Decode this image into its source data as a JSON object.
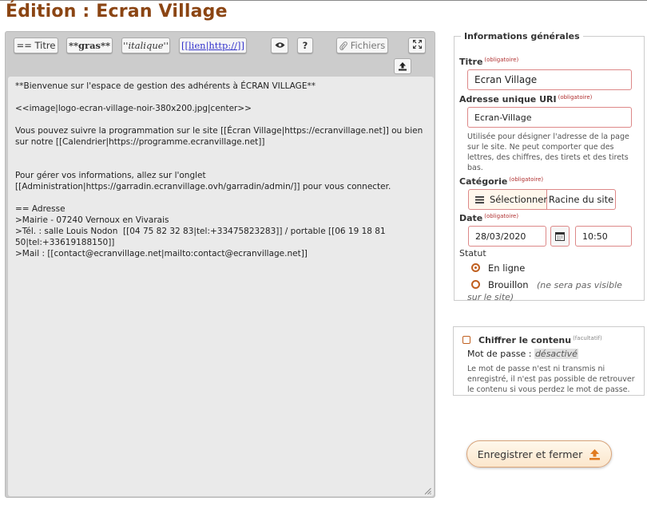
{
  "page": {
    "title": "Édition : Ecran Village"
  },
  "toolbar": {
    "titre": "== Titre",
    "gras": "**gras**",
    "italique": "''italique''",
    "lien": "[[lien|http://]]",
    "help": "?",
    "fichiers": "Fichiers",
    "preview_icon": "eye-icon",
    "fullscreen_icon": "expand-icon",
    "upload_icon": "upload-icon"
  },
  "content": {
    "lines": [
      "**Bienvenue sur l'espace de gestion des adhérents à ÉCRAN VILLAGE**",
      "",
      "<<image|logo-ecran-village-noir-380x200.jpg|center>>",
      "",
      "Vous pouvez suivre la programmation sur le site [[Écran Village|https://ecranvillage.net]] ou bien sur notre [[Calendrier|https://programme.ecranvillage.net]]",
      "",
      "",
      "Pour gérer vos informations, allez sur l'onglet [[Administration|https://garradin.ecranvillage.ovh/garradin/admin/]] pour vous connecter.",
      "",
      "== Adresse",
      ">Mairie - 07240 Vernoux en Vivarais",
      ">Tél. : salle Louis Nodon  [[04 75 82 32 83|tel:+33475823283]] / portable [[06 19 18 81 50|tel:+33619188150]]",
      ">Mail : [[contact@ecranvillage.net|mailto:contact@ecranvillage.net]]"
    ]
  },
  "infos": {
    "legend": "Informations générales",
    "required": "(obligatoire)",
    "titre_label": "Titre",
    "titre_value": "Ecran Village",
    "uri_label": "Adresse unique URI",
    "uri_value": "Ecran-Village",
    "uri_help": "Utilisée pour désigner l'adresse de la page sur le site. Ne peut comporter que des lettres, des chiffres, des tirets et des tirets bas.",
    "categorie_label": "Catégorie",
    "categorie_button": "Sélectionner",
    "categorie_value": "Racine du site",
    "date_label": "Date",
    "date_value": "28/03/2020",
    "time_value": "10:50",
    "statut_label": "Statut",
    "statut_online": "En ligne",
    "statut_draft": "Brouillon",
    "statut_draft_note": "(ne sera pas visible sur le site)"
  },
  "encryption": {
    "label": "Chiffrer le contenu",
    "optional": "(facultatif)",
    "password_label": "Mot de passe :",
    "password_value": "désactivé",
    "help": "Le mot de passe n'est ni transmis ni enregistré, il n'est pas possible de retrouver le contenu si vous perdez le mot de passe."
  },
  "actions": {
    "save_label": "Enregistrer et fermer"
  },
  "colors": {
    "accent": "#c06020",
    "title": "#8b4513",
    "required": "#b03030"
  }
}
